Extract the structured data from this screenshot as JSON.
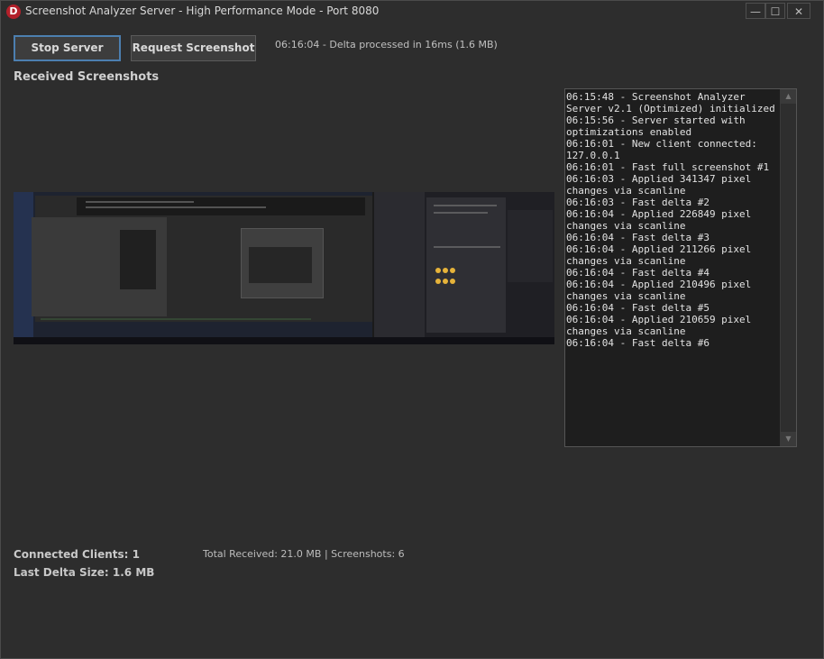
{
  "window": {
    "logo_letter": "D",
    "title": "Screenshot Analyzer Server - High Performance Mode - Port 8080",
    "controls": {
      "minimize": "—",
      "maximize": "☐",
      "close": "✕"
    }
  },
  "toolbar": {
    "stop_label": "Stop Server",
    "request_label": "Request Screenshot",
    "status": "06:16:04 - Delta processed in 16ms (1.6 MB)"
  },
  "section_title": "Received Screenshots",
  "log": {
    "text": "06:15:48 - Screenshot Analyzer Server v2.1 (Optimized) initialized\n06:15:56 - Server started with optimizations enabled\n06:16:01 - New client connected: 127.0.0.1\n06:16:01 - Fast full screenshot #1\n06:16:03 - Applied 341347 pixel changes via scanline\n06:16:03 - Fast delta #2\n06:16:04 - Applied 226849 pixel changes via scanline\n06:16:04 - Fast delta #3\n06:16:04 - Applied 211266 pixel changes via scanline\n06:16:04 - Fast delta #4\n06:16:04 - Applied 210496 pixel changes via scanline\n06:16:04 - Fast delta #5\n06:16:04 - Applied 210659 pixel changes via scanline\n06:16:04 - Fast delta #6",
    "scroll_up": "▲",
    "scroll_down": "▼"
  },
  "footer": {
    "connected_clients": "Connected Clients: 1",
    "last_delta": "Last Delta Size: 1.6 MB",
    "totals": "Total Received: 21.0 MB | Screenshots: 6"
  },
  "colors": {
    "background": "#2d2d2d",
    "accent_border": "#4c7fb0",
    "logo": "#b3202a"
  }
}
